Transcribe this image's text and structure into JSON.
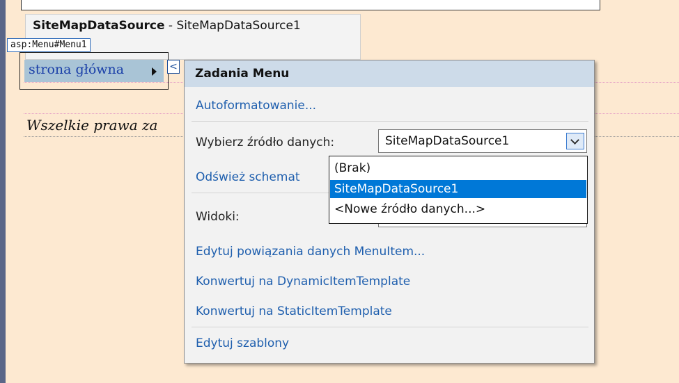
{
  "designer": {
    "sitemap_control": {
      "type_name": "SiteMapDataSource",
      "separator": " - ",
      "instance_name": "SiteMapDataSource1"
    },
    "menu_control_tag": "asp:Menu#Menu1",
    "menu_item_label": "strona główna",
    "footer_text": "Wszelkie prawa za"
  },
  "smart_tag_glyph": "<",
  "tasks_panel": {
    "title": "Zadania Menu",
    "autoformat_link": "Autoformatowanie...",
    "data_source_label": "Wybierz źródło danych:",
    "data_source_value": "SiteMapDataSource1",
    "refresh_link": "Odśwież schemat",
    "views_label": "Widoki:",
    "edit_bindings_link": "Edytuj powiązania danych MenuItem...",
    "convert_dynamic_link": "Konwertuj na DynamicItemTemplate",
    "convert_static_link": "Konwertuj na StaticItemTemplate",
    "edit_templates_link": "Edytuj szablony"
  },
  "data_source_dropdown": {
    "options": [
      "(Brak)",
      "SiteMapDataSource1",
      "<Nowe źródło danych...>"
    ],
    "selected_index": 1
  },
  "colors": {
    "designer_background": "#fde9d1",
    "link": "#1f5fae",
    "panel_header": "#cddbe9",
    "selection": "#0078d7"
  }
}
